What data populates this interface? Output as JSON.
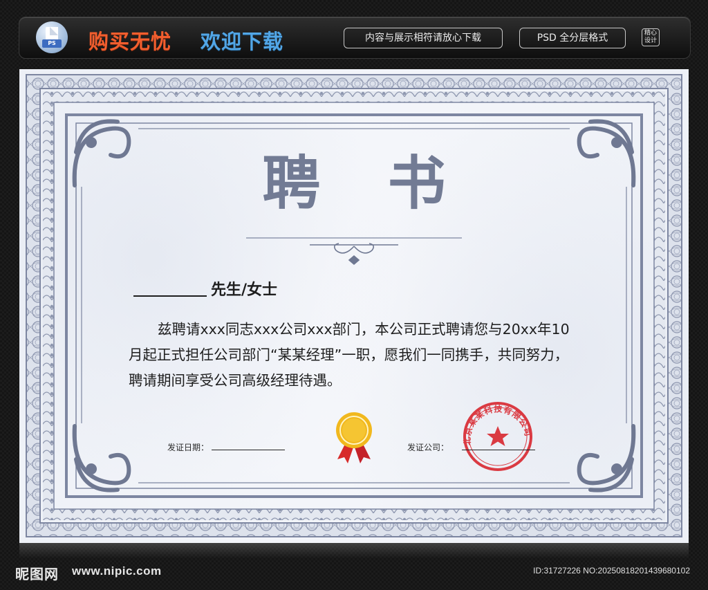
{
  "banner": {
    "icon_label": "PS",
    "slogan_primary": "购买无忧",
    "slogan_secondary": "欢迎下载",
    "tag_consistent": "内容与展示相符请放心下载",
    "tag_format": "PSD 全分层格式",
    "badge_line1": "精心",
    "badge_line2": "设计"
  },
  "certificate": {
    "title": "聘 书",
    "salutation": "先生/女士",
    "body": "兹聘请xxx同志xxx公司xxx部门，本公司正式聘请您与20xx年10月起正式担任公司部门“某某经理”一职，愿我们一同携手，共同努力，聘请期间享受公司高级经理待遇。",
    "date_label": "发证日期：",
    "company_label": "发证公司：",
    "seal_text": "北京某某科技有限公司",
    "colors": {
      "frame": "#7d86a1",
      "title": "#727b94",
      "seal": "#d8222a",
      "medal": "#f1b81e",
      "ribbon": "#d72a2a"
    }
  },
  "footer": {
    "site_logo": "昵图网",
    "site_url": "www.nipic.com",
    "image_id": "ID:31727226 NO:20250818201439680102"
  },
  "icons": [
    "photoshop-file-icon",
    "gold-medal-icon",
    "red-seal-stamp",
    "corner-scroll-ornament",
    "center-flourish-ornament"
  ]
}
